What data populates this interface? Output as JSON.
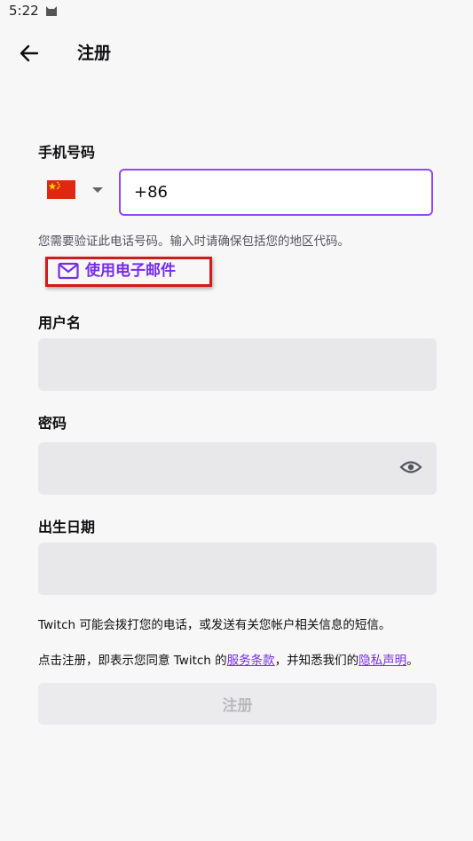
{
  "status_bar": {
    "time": "5:22"
  },
  "header": {
    "title": "注册"
  },
  "phone": {
    "label": "手机号码",
    "country_flag": "china-flag-icon",
    "value": "+86",
    "hint": "您需要验证此电话号码。输入时请确保包括您的地区代码。"
  },
  "email_link": {
    "label": "使用电子邮件",
    "icon": "mail-icon"
  },
  "username": {
    "label": "用户名",
    "value": ""
  },
  "password": {
    "label": "密码",
    "value": ""
  },
  "birthdate": {
    "label": "出生日期",
    "value": ""
  },
  "notices": {
    "sms": "Twitch 可能会拨打您的电话，或发送有关您帐户相关信息的短信。",
    "terms_prefix": "点击注册，即表示您同意 Twitch 的",
    "terms_link": "服务条款",
    "terms_middle": "，并知悉我们的",
    "privacy_link": "隐私声明",
    "terms_suffix": "。"
  },
  "submit": {
    "label": "注册"
  },
  "colors": {
    "accent": "#9147ff",
    "link": "#772ce8",
    "highlight_box": "#cf1b1b",
    "field_bg": "#e8e8ea"
  }
}
